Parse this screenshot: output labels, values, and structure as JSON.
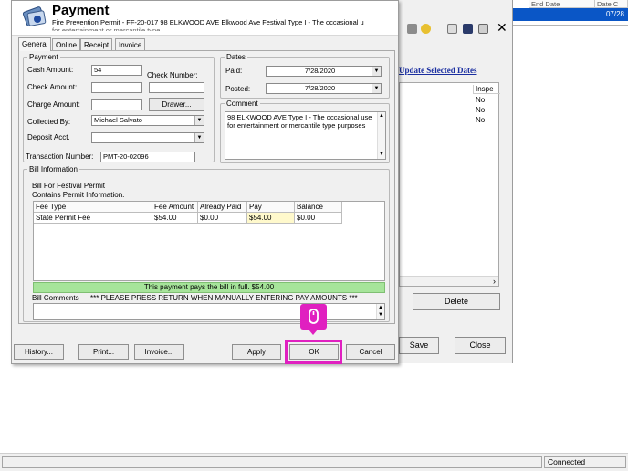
{
  "dialog": {
    "title": "Payment",
    "subtitle": "Fire Prevention Permit  - FF-20-017  98 ELKWOOD AVE  Elkwood Ave Festival  Type I - The occasional u",
    "subtitle2": "for entertainment or mercantile type",
    "tabs": [
      "General",
      "Online",
      "Receipt",
      "Invoice"
    ],
    "active_tab": "General"
  },
  "payment": {
    "group_label": "Payment",
    "cash_amount_label": "Cash Amount:",
    "cash_amount_value": "54",
    "check_number_label": "Check Number:",
    "check_number_value": "",
    "check_amount_label": "Check Amount:",
    "check_amount_value": "",
    "charge_amount_label": "Charge Amount:",
    "charge_amount_value": "",
    "drawer_button": "Drawer...",
    "collected_by_label": "Collected By:",
    "collected_by_value": "Michael Salvato",
    "deposit_acct_label": "Deposit Acct.",
    "deposit_acct_value": "",
    "transaction_number_label": "Transaction Number:",
    "transaction_number_value": "PMT-20-02096"
  },
  "dates": {
    "group_label": "Dates",
    "paid_label": "Paid:",
    "paid_value": "7/28/2020",
    "posted_label": "Posted:",
    "posted_value": "7/28/2020"
  },
  "comment": {
    "group_label": "Comment",
    "text": "98 ELKWOOD AVE Type I - The occasional use for entertainment or mercantile type purposes"
  },
  "bill": {
    "group_label": "Bill Information",
    "line1": "Bill For Festival Permit",
    "line2": "Contains Permit Information.",
    "columns": [
      "Fee Type",
      "Fee Amount",
      "Already Paid",
      "Pay",
      "Balance"
    ],
    "rows": [
      [
        "State Permit Fee",
        "$54.00",
        "$0.00",
        "$54.00",
        "$0.00"
      ]
    ],
    "status_message": "This payment pays the bill in full. $54.00",
    "comments_label": "Bill Comments",
    "comments_notice": "*** PLEASE PRESS RETURN WHEN MANUALLY ENTERING PAY AMOUNTS  ***",
    "comments_value": ""
  },
  "buttons": {
    "history": "History...",
    "print": "Print...",
    "invoice": "Invoice...",
    "apply": "Apply",
    "ok": "OK",
    "cancel": "Cancel"
  },
  "background": {
    "col_end_date": "End Date",
    "col_date": "Date C",
    "selected_date": "07/28",
    "link_update": "Update Selected Dates",
    "list_header": "Inspe",
    "list_rows": [
      "No",
      "No",
      "No"
    ],
    "delete_button": "Delete",
    "save_button": "Save",
    "close_button": "Close"
  },
  "statusbar": {
    "connection": "Connected"
  },
  "annotation": {
    "color": "#e020c0",
    "icon": "mouse-icon"
  }
}
